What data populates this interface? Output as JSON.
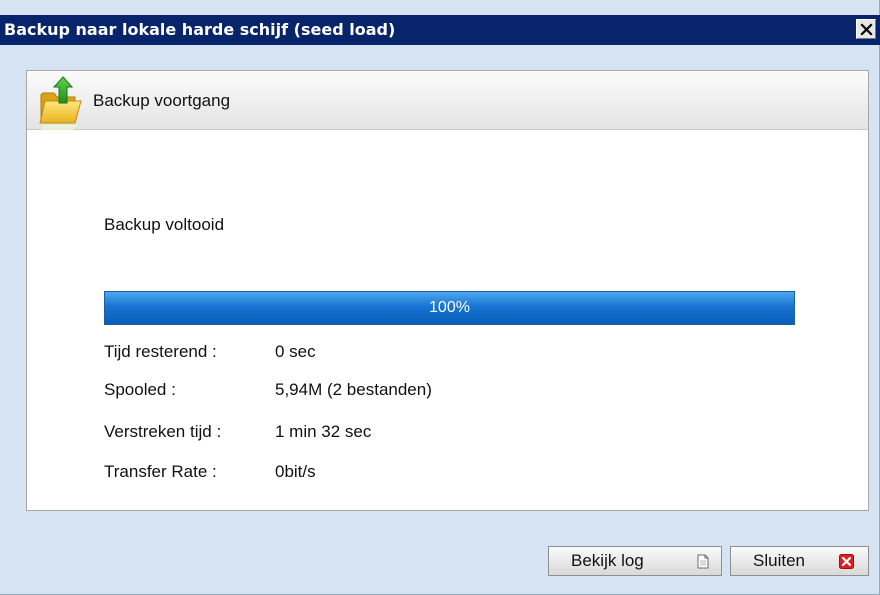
{
  "window": {
    "title": "Backup naar lokale harde schijf (seed load)",
    "close_icon": "close-icon"
  },
  "panel": {
    "header_label": "Backup voortgang",
    "header_icon": "folder-upload-icon"
  },
  "status": {
    "text": "Backup voltooid"
  },
  "progress": {
    "percent": 100,
    "label": "100%",
    "color": "#1774d3"
  },
  "stats": [
    {
      "label": "Tijd resterend :",
      "value": "0 sec"
    },
    {
      "label": "Spooled :",
      "value": "5,94M (2 bestanden)"
    },
    {
      "label": "Verstreken tijd :",
      "value": "1 min 32 sec"
    },
    {
      "label": "Transfer Rate :",
      "value": "0bit/s"
    }
  ],
  "buttons": {
    "view_log": {
      "label": "Bekijk log",
      "icon": "document-icon"
    },
    "close": {
      "label": "Sluiten",
      "icon": "red-x-icon"
    }
  },
  "colors": {
    "titlebar": "#08246b",
    "window_bg": "#d6e3f2",
    "close_red": "#e02020"
  }
}
